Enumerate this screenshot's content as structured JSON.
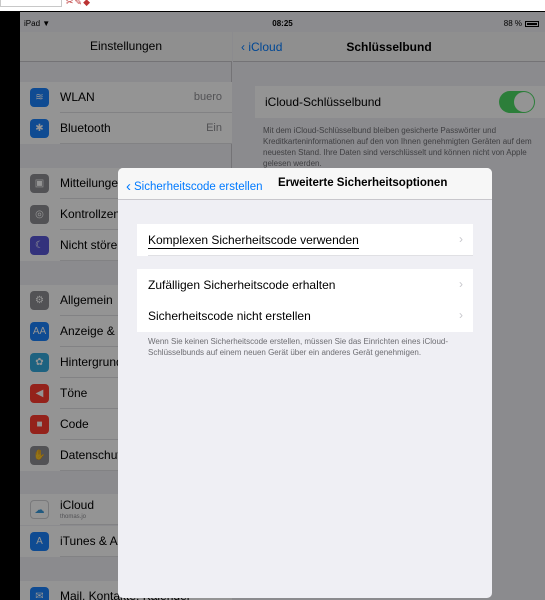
{
  "host": {
    "icons": "✂✎◆"
  },
  "status_bar": {
    "device": "iPad",
    "wifi": "▼",
    "time": "08:25",
    "battery": "88 %"
  },
  "left_pane": {
    "title": "Einstellungen",
    "items": [
      {
        "label": "WLAN",
        "value": "buero",
        "icon": "wifi-icon",
        "color": "#1a82fb",
        "glyph": "≋"
      },
      {
        "label": "Bluetooth",
        "value": "Ein",
        "icon": "bluetooth-icon",
        "color": "#1a82fb",
        "glyph": "✱"
      },
      {
        "label": "Mitteilungen",
        "value": "",
        "icon": "notifications-icon",
        "color": "#8e8e93",
        "glyph": "▣"
      },
      {
        "label": "Kontrollzentrum",
        "value": "",
        "icon": "control-center-icon",
        "color": "#8e8e93",
        "glyph": "◎"
      },
      {
        "label": "Nicht stören",
        "value": "",
        "icon": "do-not-disturb-icon",
        "color": "#5856d6",
        "glyph": "☾"
      },
      {
        "label": "Allgemein",
        "value": "",
        "icon": "general-icon",
        "color": "#8e8e93",
        "glyph": "⚙"
      },
      {
        "label": "Anzeige & Helligkeit",
        "value": "",
        "icon": "display-icon",
        "color": "#1a82fb",
        "glyph": "AA"
      },
      {
        "label": "Hintergrundbild",
        "value": "",
        "icon": "wallpaper-icon",
        "color": "#35aadc",
        "glyph": "✿"
      },
      {
        "label": "Töne",
        "value": "",
        "icon": "sounds-icon",
        "color": "#ff3b30",
        "glyph": "◀"
      },
      {
        "label": "Code",
        "value": "",
        "icon": "passcode-icon",
        "color": "#ff3b30",
        "glyph": "■"
      },
      {
        "label": "Datenschutz",
        "value": "",
        "icon": "privacy-icon",
        "color": "#8e8e93",
        "glyph": "✋"
      },
      {
        "label": "iCloud",
        "value": "",
        "sub": "thomas.jo",
        "icon": "icloud-icon",
        "color": "#ffffff",
        "glyph": "☁"
      },
      {
        "label": "iTunes & App Store",
        "value": "",
        "icon": "itunes-icon",
        "color": "#1a82fb",
        "glyph": "A"
      },
      {
        "label": "Mail, Kontakte, Kalender",
        "value": "",
        "icon": "mail-icon",
        "color": "#1a82fb",
        "glyph": "✉"
      }
    ]
  },
  "right_pane": {
    "back": "iCloud",
    "title": "Schlüsselbund",
    "keychain_label": "iCloud-Schlüsselbund",
    "keychain_on": true,
    "description": "Mit dem iCloud-Schlüsselbund bleiben gesicherte Passwörter und Kreditkarteninformationen auf den von Ihnen genehmigten Geräten auf dem neuesten Stand. Ihre Daten sind verschlüsselt und können nicht von Apple gelesen werden."
  },
  "modal": {
    "back": "Sicherheitscode erstellen",
    "title": "Erweiterte Sicherheitsoptionen",
    "options": [
      "Komplexen Sicherheitscode verwenden",
      "Zufälligen Sicherheitscode erhalten",
      "Sicherheitscode nicht erstellen"
    ],
    "note": "Wenn Sie keinen Sicherheitscode erstellen, müssen Sie das Einrichten eines iCloud-Schlüsselbunds auf einem neuen Gerät über ein anderes Gerät genehmigen."
  },
  "colors": {
    "accent": "#007aff",
    "toggle_on": "#4cd964",
    "background": "#efeff4"
  }
}
